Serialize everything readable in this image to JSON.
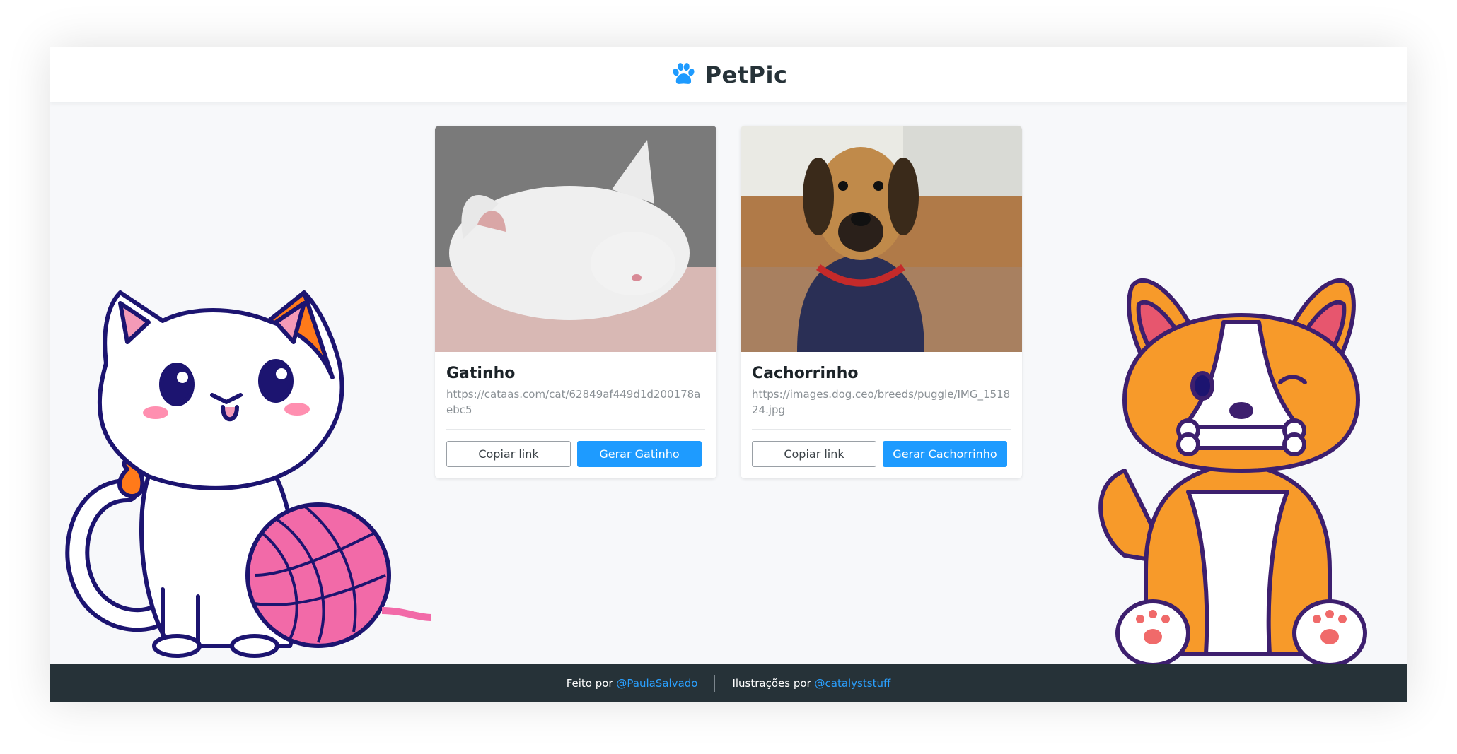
{
  "app": {
    "name": "PetPic"
  },
  "cards": [
    {
      "title": "Gatinho",
      "url": "https://cataas.com/cat/62849af449d1d200178aebc5",
      "copy_label": "Copiar link",
      "generate_label": "Gerar Gatinho"
    },
    {
      "title": "Cachorrinho",
      "url": "https://images.dog.ceo/breeds/puggle/IMG_151824.jpg",
      "copy_label": "Copiar link",
      "generate_label": "Gerar Cachorrinho"
    }
  ],
  "footer": {
    "made_by_label": "Feito por",
    "made_by_link": "@PaulaSalvado",
    "illustrations_label": "Ilustrações por",
    "illustrations_link": "@catalyststuff"
  },
  "colors": {
    "primary": "#1e9bff",
    "header_bg": "#ffffff",
    "page_bg": "#f7f8fa",
    "footer_bg": "#263238",
    "logo_text": "#263238",
    "paw": "#1e9bff"
  },
  "icons": {
    "logo": "paw-icon"
  }
}
